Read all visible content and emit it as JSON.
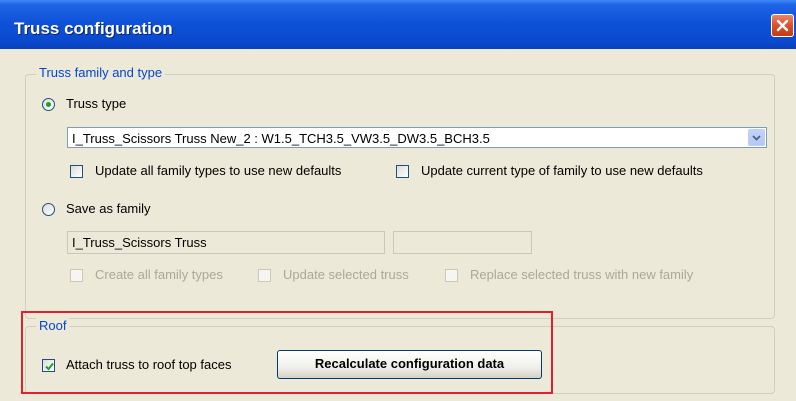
{
  "window": {
    "title": "Truss configuration"
  },
  "family_group": {
    "title": "Truss family and type",
    "truss_type_option": {
      "label": "Truss type",
      "selected": true
    },
    "truss_type_value": "I_Truss_Scissors Truss New_2 : W1.5_TCH3.5_VW3.5_DW3.5_BCH3.5",
    "update_all_types": {
      "label": "Update all family types to use new defaults",
      "checked": false
    },
    "update_current_type": {
      "label": "Update current type of family to use new defaults",
      "checked": false
    },
    "save_as_family_option": {
      "label": "Save as family",
      "selected": false
    },
    "family_name_value": "I_Truss_Scissors Truss",
    "family_suffix_value": "",
    "create_all_types": {
      "label": "Create all family types",
      "checked": false
    },
    "update_selected_truss": {
      "label": "Update selected truss",
      "checked": false
    },
    "replace_selected_truss": {
      "label": "Replace selected truss with new family",
      "checked": false
    }
  },
  "roof_group": {
    "title": "Roof",
    "attach_truss": {
      "label": "Attach truss to roof top faces",
      "checked": true
    },
    "recalculate_button": "Recalculate configuration data"
  },
  "colors": {
    "title_bar": "#0a49cf",
    "group_title": "#0046d5",
    "highlight_box": "#e0202a"
  }
}
